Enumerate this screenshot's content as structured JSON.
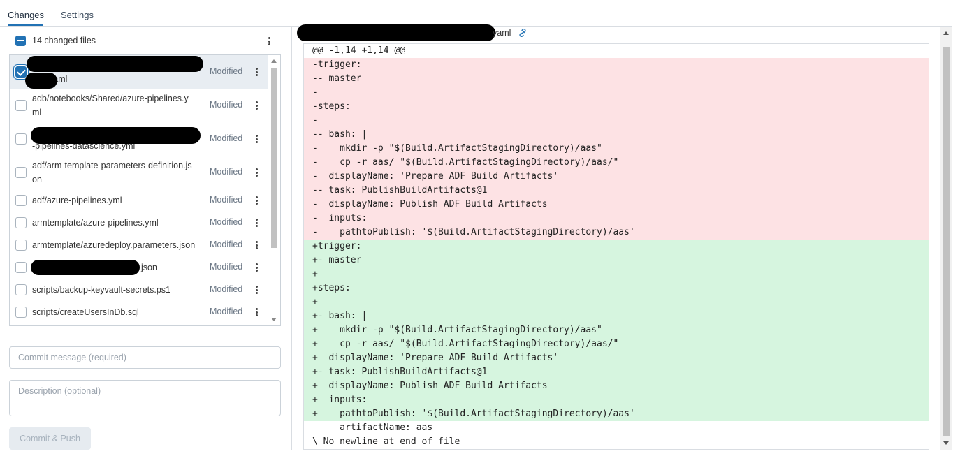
{
  "tabs": [
    {
      "label": "Changes",
      "active": true
    },
    {
      "label": "Settings",
      "active": false
    }
  ],
  "files_header": {
    "label": "14 changed files"
  },
  "files": [
    {
      "name_lines": [
        "",
        "yaml"
      ],
      "status": "Modified",
      "checked": true,
      "selected": true
    },
    {
      "name_lines": [
        "adb/notebooks/Shared/azure-pipelines.y",
        "ml"
      ],
      "status": "Modified",
      "checked": false
    },
    {
      "name_lines": [
        "",
        "-pipelines-datascience.yml"
      ],
      "status": "Modified",
      "checked": false
    },
    {
      "name_lines": [
        "adf/arm-template-parameters-definition.js",
        "on"
      ],
      "status": "Modified",
      "checked": false
    },
    {
      "name_lines": [
        "adf/azure-pipelines.yml"
      ],
      "status": "Modified",
      "checked": false
    },
    {
      "name_lines": [
        "armtemplate/azure-pipelines.yml"
      ],
      "status": "Modified",
      "checked": false
    },
    {
      "name_lines": [
        "armtemplate/azuredeploy.parameters.json"
      ],
      "status": "Modified",
      "checked": false
    },
    {
      "name_lines": [
        "json"
      ],
      "status": "Modified",
      "checked": false
    },
    {
      "name_lines": [
        "scripts/backup-keyvault-secrets.ps1"
      ],
      "status": "Modified",
      "checked": false
    },
    {
      "name_lines": [
        "scripts/createUsersInDb.sql"
      ],
      "status": "Modified",
      "checked": false
    }
  ],
  "commit": {
    "message_placeholder": "Commit message (required)",
    "description_placeholder": "Description (optional)",
    "button_label": "Commit & Push"
  },
  "diff": {
    "file_title": "yaml",
    "lines": [
      {
        "type": "hunk",
        "text": "@@ -1,14 +1,14 @@"
      },
      {
        "type": "del",
        "text": "-trigger:"
      },
      {
        "type": "del",
        "text": "-- master"
      },
      {
        "type": "del",
        "text": "-"
      },
      {
        "type": "del",
        "text": "-steps:"
      },
      {
        "type": "del",
        "text": "-"
      },
      {
        "type": "del",
        "text": "-- bash: |"
      },
      {
        "type": "del",
        "text": "-    mkdir -p \"$(Build.ArtifactStagingDirectory)/aas\""
      },
      {
        "type": "del",
        "text": "-    cp -r aas/ \"$(Build.ArtifactStagingDirectory)/aas/\""
      },
      {
        "type": "del",
        "text": "-  displayName: 'Prepare ADF Build Artifacts'"
      },
      {
        "type": "del",
        "text": "-- task: PublishBuildArtifacts@1"
      },
      {
        "type": "del",
        "text": "-  displayName: Publish ADF Build Artifacts"
      },
      {
        "type": "del",
        "text": "-  inputs:"
      },
      {
        "type": "del",
        "text": "-    pathtoPublish: '$(Build.ArtifactStagingDirectory)/aas'"
      },
      {
        "type": "add",
        "text": "+trigger:"
      },
      {
        "type": "add",
        "text": "+- master"
      },
      {
        "type": "add",
        "text": "+"
      },
      {
        "type": "add",
        "text": "+steps:"
      },
      {
        "type": "add",
        "text": "+"
      },
      {
        "type": "add",
        "text": "+- bash: |"
      },
      {
        "type": "add",
        "text": "+    mkdir -p \"$(Build.ArtifactStagingDirectory)/aas\""
      },
      {
        "type": "add",
        "text": "+    cp -r aas/ \"$(Build.ArtifactStagingDirectory)/aas/\""
      },
      {
        "type": "add",
        "text": "+  displayName: 'Prepare ADF Build Artifacts'"
      },
      {
        "type": "add",
        "text": "+- task: PublishBuildArtifacts@1"
      },
      {
        "type": "add",
        "text": "+  displayName: Publish ADF Build Artifacts"
      },
      {
        "type": "add",
        "text": "+  inputs:"
      },
      {
        "type": "add",
        "text": "+    pathtoPublish: '$(Build.ArtifactStagingDirectory)/aas'"
      },
      {
        "type": "ctx",
        "text": "     artifactName: aas"
      },
      {
        "type": "ctx",
        "text": "\\ No newline at end of file"
      }
    ]
  },
  "colors": {
    "accent": "#2272b4",
    "deleted_bg": "#fde2e4",
    "added_bg": "#d6f5df"
  }
}
